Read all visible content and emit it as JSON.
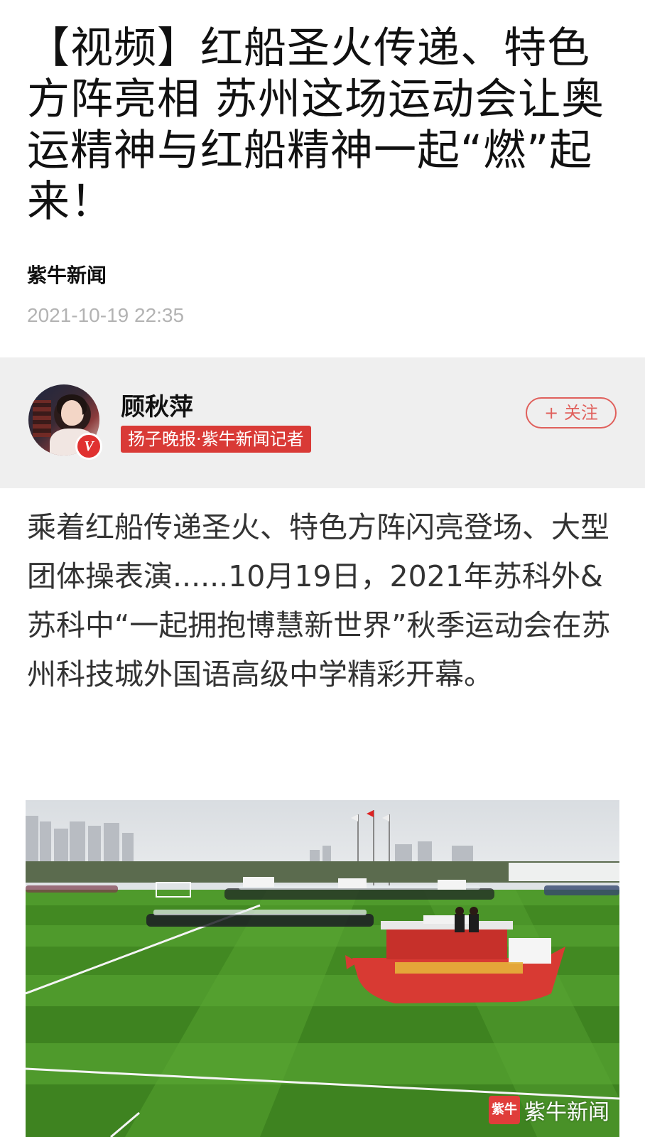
{
  "article": {
    "title": "【视频】红船圣火传递、特色方阵亮相 苏州这场运动会让奥运精神与红船精神一起“燃”起来！",
    "source": "紫牛新闻",
    "datetime": "2021-10-19 22:35"
  },
  "author": {
    "name": "顾秋萍",
    "tag": "扬子晚报·紫牛新闻记者",
    "verified_badge": "V",
    "follow_label": "+ 关注",
    "avatar_icon": "avatar-photo"
  },
  "body": {
    "paragraph_1": "乘着红船传递圣火、特色方阵闪亮登场、大型团体操表演......10月19日，2021年苏科外&苏科中“一起拥抱博慧新世界”秋季运动会在苏州科技城外国语高级中学精彩开幕。"
  },
  "photo": {
    "watermark_text": "紫牛新闻",
    "watermark_logo": "紫牛",
    "colors": {
      "grass_light": "#4f9a2c",
      "grass_dark": "#3a7d1e",
      "sky": "#e3e6e9",
      "boat_red": "#d83a33"
    }
  },
  "colors": {
    "accent": "#d93a36",
    "author_card_bg": "#efefef",
    "meta_gray": "#b3b3b3"
  }
}
